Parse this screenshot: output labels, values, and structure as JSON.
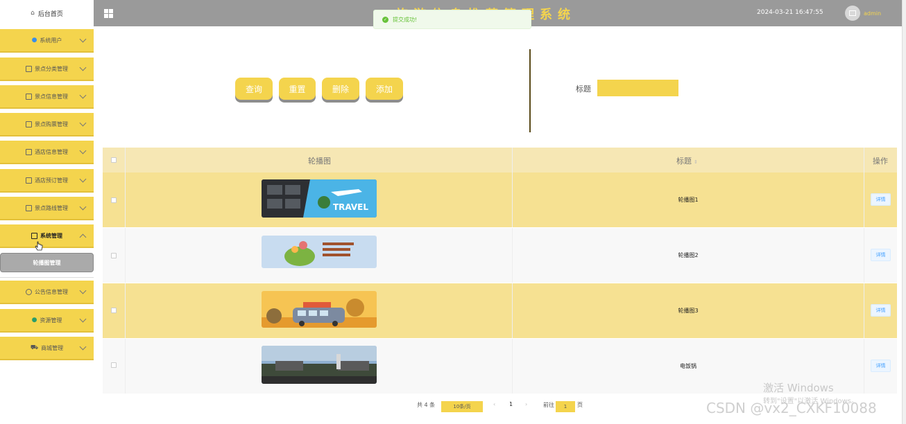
{
  "sidebar": {
    "home": "后台首页",
    "items": [
      {
        "label": "系统用户",
        "icon": "user-icon"
      },
      {
        "label": "景点分类管理",
        "icon": "doc-icon"
      },
      {
        "label": "景点信息管理",
        "icon": "doc-icon"
      },
      {
        "label": "景点购票管理",
        "icon": "doc-icon"
      },
      {
        "label": "酒店信息管理",
        "icon": "doc-icon"
      },
      {
        "label": "酒店预订管理",
        "icon": "doc-icon"
      },
      {
        "label": "景点路线管理",
        "icon": "doc-icon"
      },
      {
        "label": "系统管理",
        "icon": "picture-icon"
      },
      {
        "label": "公告信息管理",
        "icon": "info-icon"
      },
      {
        "label": "资源管理",
        "icon": "location-icon"
      },
      {
        "label": "商城管理",
        "icon": "cart-icon"
      }
    ],
    "sub_item": "轮播图管理"
  },
  "header": {
    "system_title": "旅游信息推荐管理系统",
    "datetime": "2024-03-21 16:47:55",
    "username": "admin"
  },
  "toast": {
    "message": "提交成功!"
  },
  "actions": {
    "search": "查询",
    "reset": "重置",
    "delete": "删除",
    "add": "添加"
  },
  "filter": {
    "label": "标题",
    "value": ""
  },
  "table": {
    "headers": {
      "image": "轮播图",
      "title": "标题",
      "ops": "操作"
    },
    "rows": [
      {
        "title": "轮播图1",
        "action": "详情"
      },
      {
        "title": "轮播图2",
        "action": "详情"
      },
      {
        "title": "轮播图3",
        "action": "详情"
      },
      {
        "title": "电饭锅",
        "action": "详情"
      }
    ]
  },
  "pagination": {
    "total": "共 4 条",
    "page_size": "10条/页",
    "prev": "‹",
    "page": "1",
    "next": "›",
    "goto_label": "前往",
    "goto_value": "1",
    "page_suffix": "页"
  },
  "watermark": {
    "activate_line1": "激活 Windows",
    "activate_line2": "转到\"设置\"以激活 Windows。",
    "csdn": "CSDN @vx2_CXKF10088"
  },
  "colors": {
    "accent": "#f4d44d",
    "topbar": "#9a9a9a",
    "row_highlight": "#f6e192"
  }
}
